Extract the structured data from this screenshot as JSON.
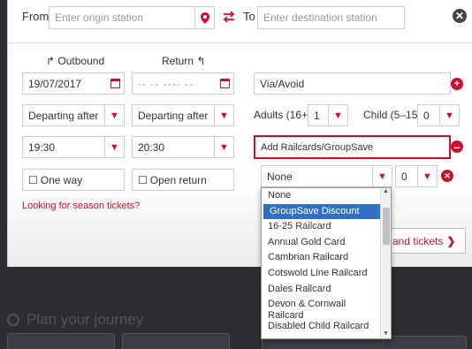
{
  "origin": {
    "label": "From",
    "placeholder": "Enter origin station"
  },
  "destination": {
    "label": "To",
    "placeholder": "Enter destination station"
  },
  "outbound": {
    "label": "Outbound",
    "date": "19/07/2017",
    "time_mode": "Departing after",
    "time": "19:30"
  },
  "return": {
    "label": "Return",
    "date": "-- -- ---- --",
    "time_mode": "Departing after",
    "time": "20:30"
  },
  "one_way_label": "One way",
  "open_return_label": "Open return",
  "season_link": "Looking for season tickets?",
  "via_avoid": "Via/Avoid",
  "adults": {
    "label": "Adults (16+)",
    "value": "1"
  },
  "child": {
    "label": "Child (5–15)",
    "value": "0"
  },
  "railcards": {
    "label": "Add Railcards/GroupSave",
    "selected": "None",
    "count": "0",
    "options": [
      "None",
      "GroupSave Discount",
      "16-25 Railcard",
      "Annual Gold Card",
      "Cambrian Railcard",
      "Cotswold Line Railcard",
      "Dales Railcard",
      "Devon & Cornwall Railcard",
      "Disabled Child Railcard"
    ],
    "highlighted_index": 1
  },
  "find_tickets": "and tickets",
  "plan_journey": "Plan your journey",
  "colors": {
    "accent": "#c8102e",
    "highlight": "#2f6fc6"
  }
}
